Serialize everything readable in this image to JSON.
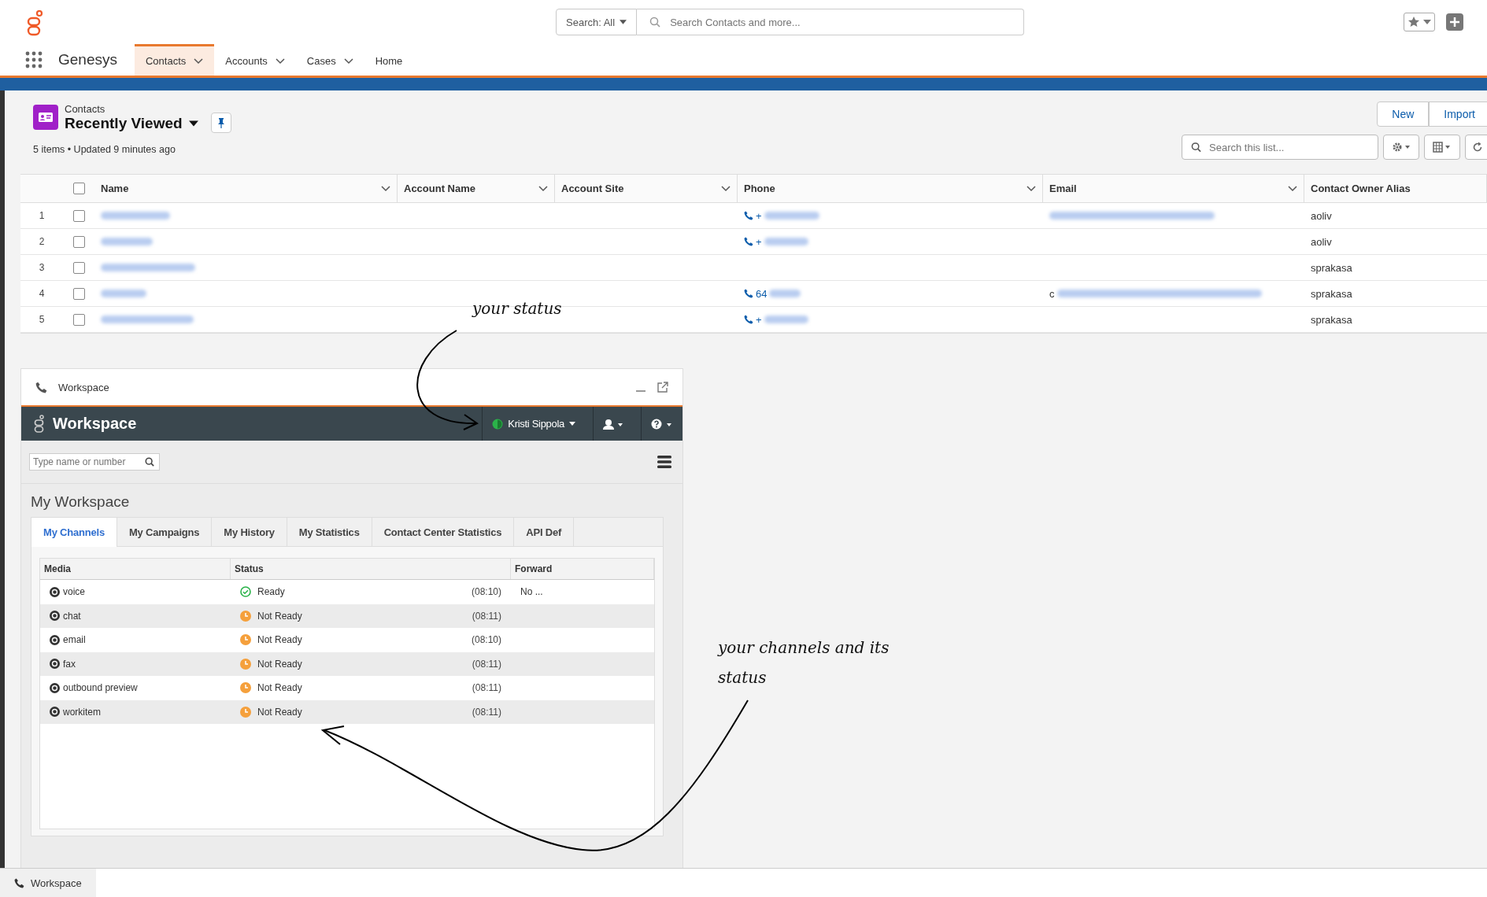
{
  "header": {
    "search_scope": "Search: All",
    "search_placeholder": "Search Contacts and more...",
    "app_name": "Genesys",
    "nav": [
      {
        "label": "Contacts",
        "selected": true,
        "dropdown": true
      },
      {
        "label": "Accounts",
        "selected": false,
        "dropdown": true
      },
      {
        "label": "Cases",
        "selected": false,
        "dropdown": true
      },
      {
        "label": "Home",
        "selected": false,
        "dropdown": false
      }
    ]
  },
  "list": {
    "object": "Contacts",
    "view": "Recently Viewed",
    "summary": "5 items • Updated 9 minutes ago",
    "buttons": [
      "New",
      "Import"
    ],
    "search_placeholder": "Search this list...",
    "select_all_checked": false,
    "columns": [
      "Name",
      "Account Name",
      "Account Site",
      "Phone",
      "Email",
      "Contact Owner Alias"
    ],
    "rows": [
      {
        "number": "1",
        "checked": false,
        "phone_prefix": "+",
        "email_prefix": "",
        "owner": "aoliv"
      },
      {
        "number": "2",
        "checked": false,
        "phone_prefix": "+",
        "email_prefix": "",
        "owner": "aoliv"
      },
      {
        "number": "3",
        "checked": false,
        "phone_prefix": "",
        "email_prefix": "",
        "owner": "sprakasa"
      },
      {
        "number": "4",
        "checked": false,
        "phone_prefix": "64",
        "email_prefix": "c",
        "owner": "sprakasa"
      },
      {
        "number": "5",
        "checked": false,
        "phone_prefix": "+",
        "email_prefix": "",
        "owner": "sprakasa"
      }
    ]
  },
  "workspace": {
    "window_title": "Workspace",
    "title": "Workspace",
    "agent": "Kristi Sippola",
    "search_placeholder": "Type name or number",
    "section": "My Workspace",
    "tabs": [
      {
        "label": "My Channels",
        "selected": true
      },
      {
        "label": "My Campaigns",
        "selected": false
      },
      {
        "label": "My History",
        "selected": false
      },
      {
        "label": "My Statistics",
        "selected": false
      },
      {
        "label": "Contact Center Statistics",
        "selected": false
      },
      {
        "label": "API Def",
        "selected": false
      }
    ],
    "columns": [
      "Media",
      "Status",
      "Forward"
    ],
    "channels": [
      {
        "media": "voice",
        "status": "Ready",
        "kind": "ready",
        "time": "(08:10)",
        "forward": "No ..."
      },
      {
        "media": "chat",
        "status": "Not Ready",
        "kind": "not_ready",
        "time": "(08:11)"
      },
      {
        "media": "email",
        "status": "Not Ready",
        "kind": "not_ready",
        "time": "(08:10)"
      },
      {
        "media": "fax",
        "status": "Not Ready",
        "kind": "not_ready",
        "time": "(08:11)"
      },
      {
        "media": "outbound preview",
        "status": "Not Ready",
        "kind": "not_ready",
        "time": "(08:11)"
      },
      {
        "media": "workitem",
        "status": "Not Ready",
        "kind": "not_ready",
        "time": "(08:11)"
      }
    ]
  },
  "footer_tab": "Workspace",
  "annotations": [
    "your status",
    "your channels and its status"
  ]
}
